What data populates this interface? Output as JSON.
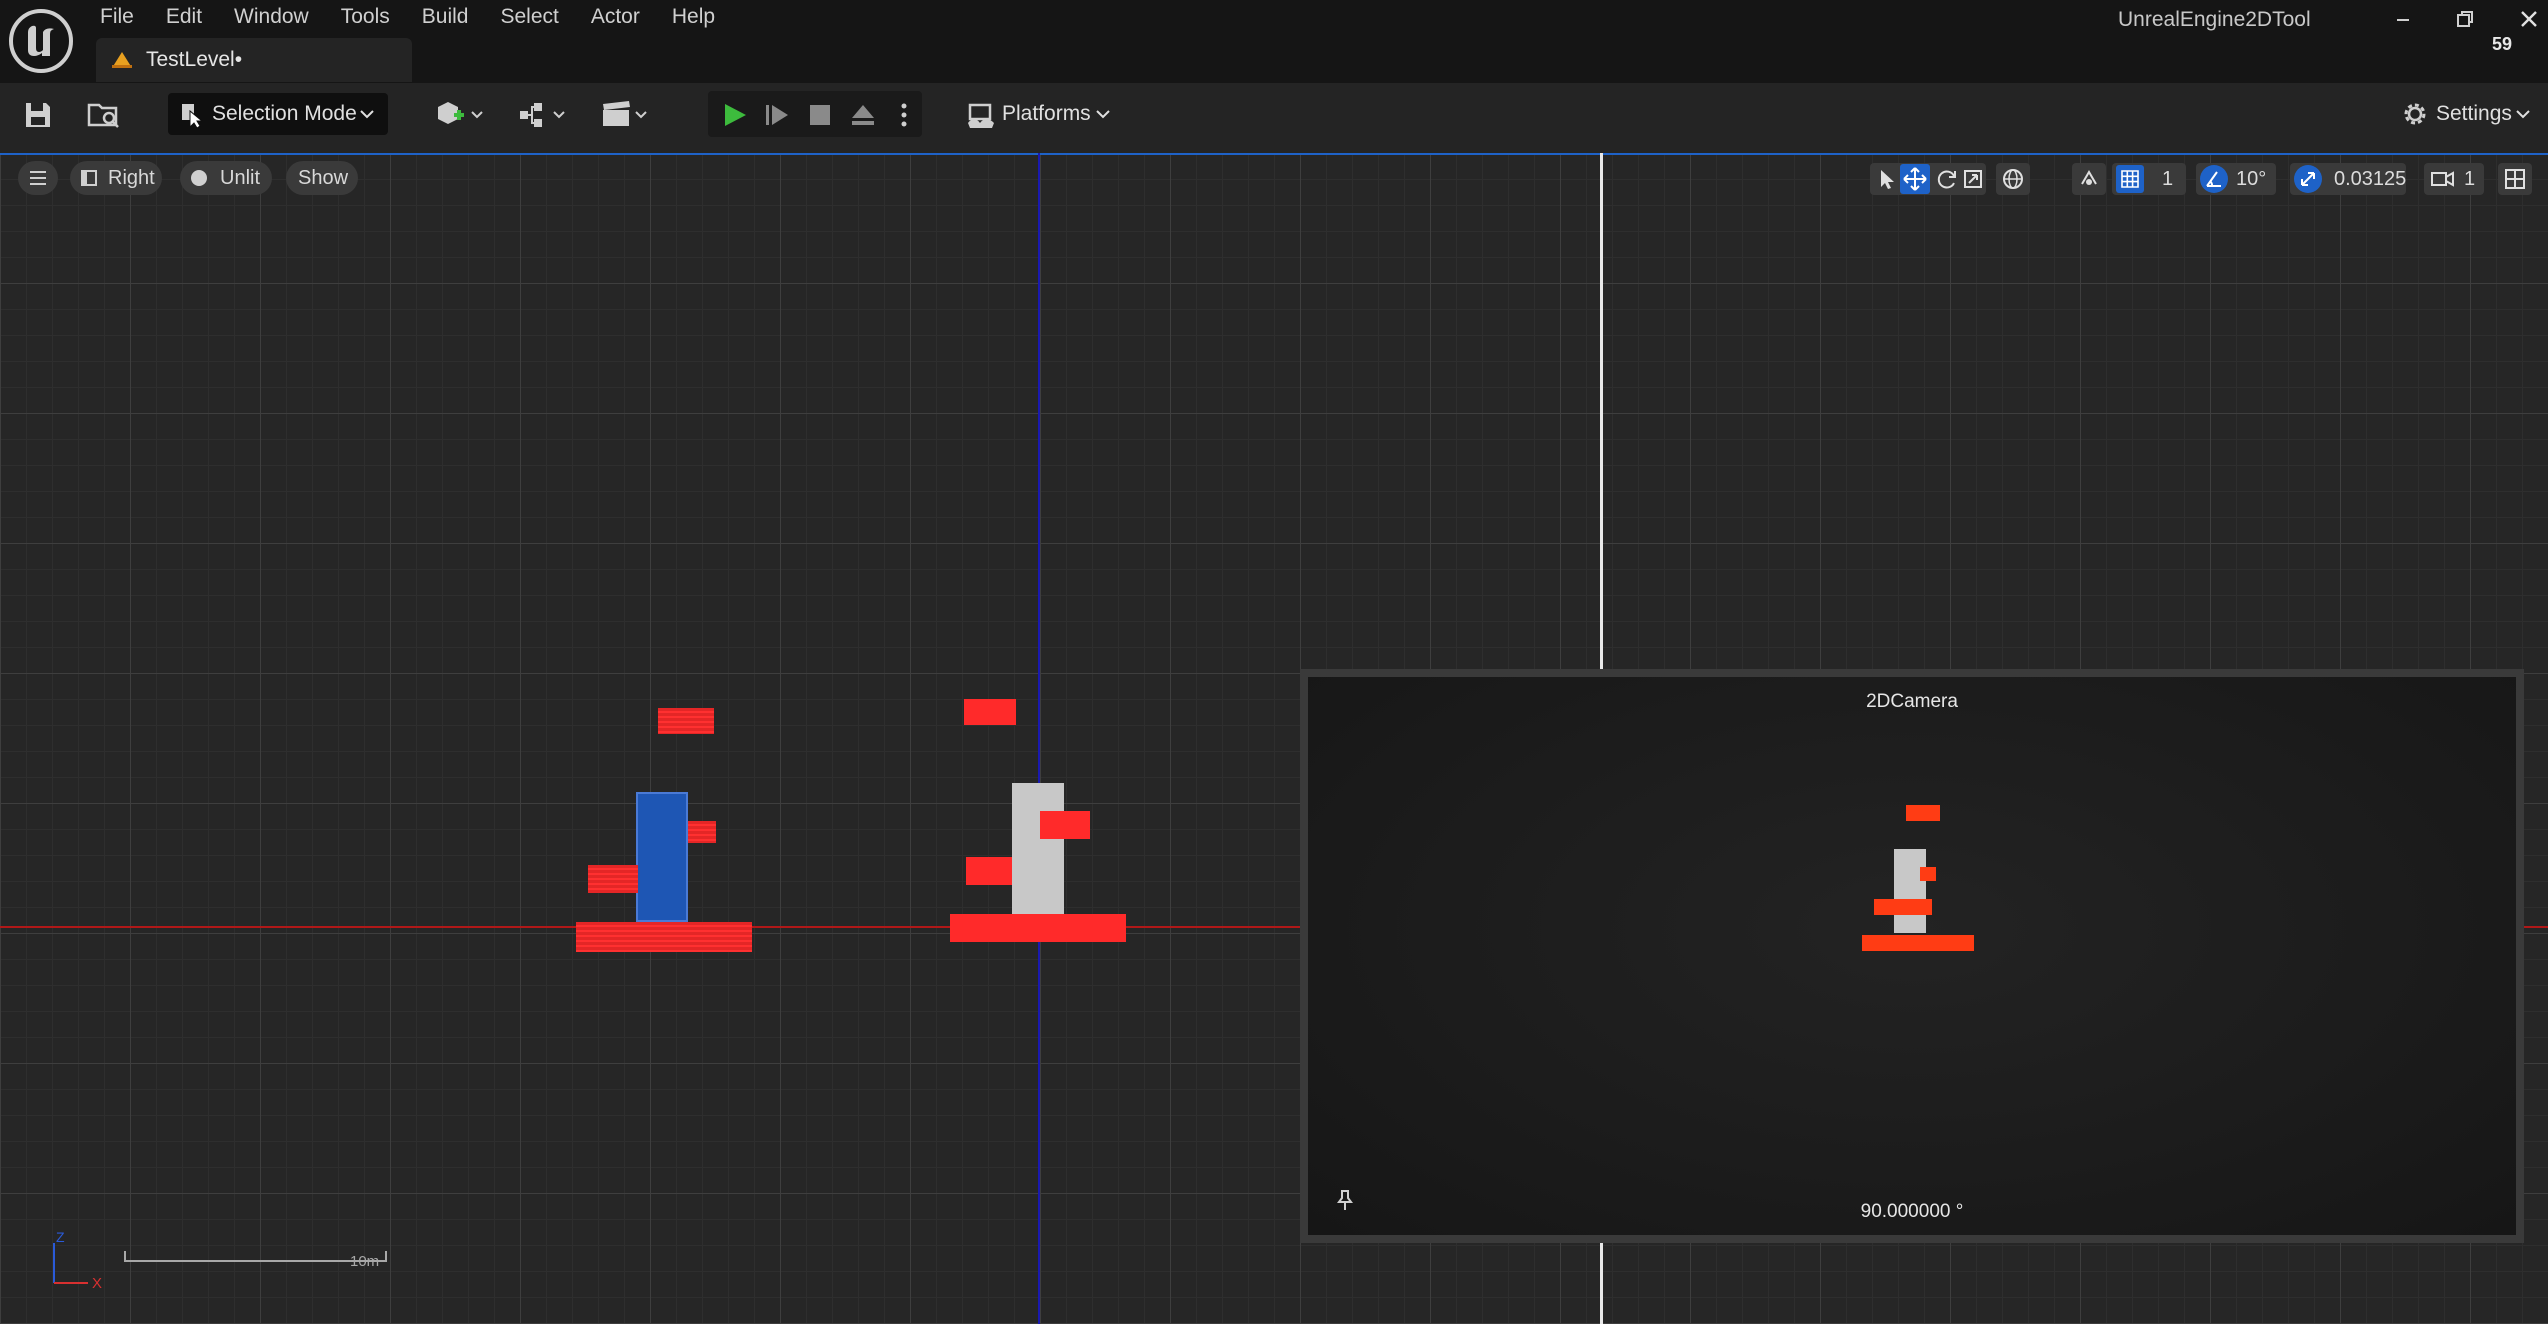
{
  "title_bar": {
    "menu": [
      "File",
      "Edit",
      "Window",
      "Tools",
      "Build",
      "Select",
      "Actor",
      "Help"
    ],
    "document_tab": "TestLevel•",
    "app_title": "UnrealEngine2DTool",
    "fps": "59"
  },
  "toolbar": {
    "selection_mode": "Selection Mode",
    "platforms": "Platforms",
    "settings": "Settings"
  },
  "viewport": {
    "view_mode_label": "Right",
    "lighting_label": "Unlit",
    "show_label": "Show",
    "grid_snap": "1",
    "rotation_snap": "10°",
    "scale_snap": "0.03125",
    "camera_speed": "1",
    "scale_bar_label": "10m",
    "axis_x_label": "X",
    "axis_z_label": "Z"
  },
  "camera_preview": {
    "title": "2DCamera",
    "angle": "90.000000 °"
  },
  "colors": {
    "accent": "#1e62c8",
    "play_green": "#3dbb3d",
    "selected_blue": "#1e56b4",
    "block_red": "#ff2a2a",
    "preview_orange": "#ff3c14"
  }
}
